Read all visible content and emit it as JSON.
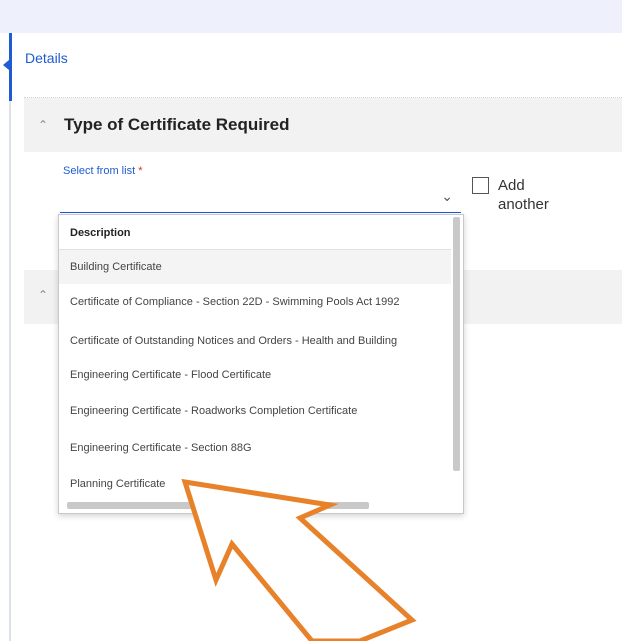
{
  "nav": {
    "details_tab": "Details"
  },
  "section": {
    "title": "Type of Certificate Required",
    "field_label": "Select from list",
    "required_mark": "*",
    "add_another": "Add another"
  },
  "dropdown": {
    "header": "Description",
    "options": [
      "Building Certificate",
      "Certificate of Compliance - Section 22D - Swimming Pools Act 1992",
      "Certificate of Outstanding Notices and Orders - Health and Building",
      "Engineering Certificate - Flood Certificate",
      "Engineering Certificate - Roadworks Completion Certificate",
      "Engineering Certificate - Section 88G",
      "Planning Certificate"
    ]
  },
  "colors": {
    "accent": "#1f5bd1",
    "required": "#d0312d",
    "annotation_arrow": "#e8822a",
    "section_bg": "#f2f2f2"
  }
}
